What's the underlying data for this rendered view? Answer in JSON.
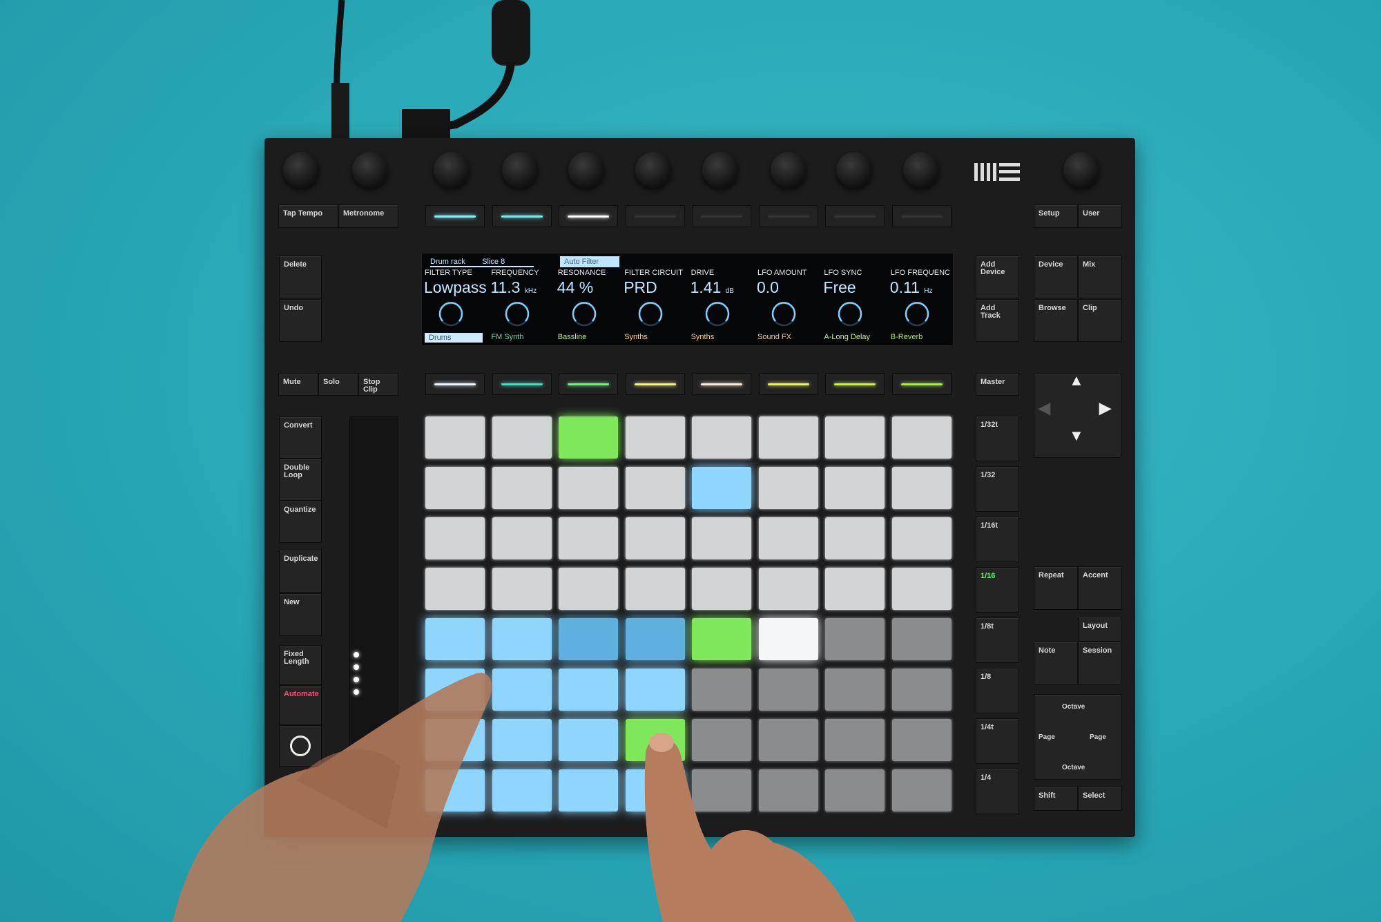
{
  "device": {
    "logo": "ableton-logo",
    "top_left_buttons": [
      "Tap Tempo",
      "Metronome"
    ],
    "edit_buttons": [
      "Delete",
      "Undo"
    ],
    "track_buttons": [
      "Mute",
      "Solo",
      "Stop Clip"
    ],
    "left_column_a": [
      "Convert",
      "Double Loop",
      "Quantize"
    ],
    "left_column_b": [
      "Duplicate",
      "New"
    ],
    "left_column_c": [
      "Fixed Length",
      "Automate"
    ],
    "add_buttons": [
      "Add Device",
      "Add Track"
    ],
    "mode_buttons": [
      "Device",
      "Mix",
      "Browse",
      "Clip"
    ],
    "setup_buttons": [
      "Setup",
      "User"
    ],
    "master": "Master",
    "scene_buttons": [
      "1/32t",
      "1/32",
      "1/16t",
      "1/16",
      "1/8t",
      "1/8",
      "1/4t",
      "1/4"
    ],
    "active_scene": "1/16",
    "repeat_buttons": [
      "Repeat",
      "Accent"
    ],
    "layout_buttons": {
      "layout": "Layout",
      "note": "Note",
      "session": "Session"
    },
    "octave_pad": {
      "up": "Octave",
      "down": "Octave",
      "left": "Page",
      "right": "Page"
    },
    "bottom_buttons": [
      "Shift",
      "Select"
    ],
    "upper_strip_leds": [
      "#8ff0ff",
      "#7fe8f0",
      "#ffffff",
      "#333",
      "#333",
      "#333",
      "#333",
      "#333"
    ],
    "lower_strip_leds": [
      "#e8f4ff",
      "#3fe0c0",
      "#6ef07a",
      "#f2f07a",
      "#ffe8d0",
      "#e8f060",
      "#c8f040",
      "#a0f040"
    ]
  },
  "display": {
    "breadcrumb": [
      "Drum rack",
      "Slice 8"
    ],
    "device_tab": "Auto Filter",
    "params": [
      {
        "name": "FILTER TYPE",
        "value": "Lowpass",
        "unit": ""
      },
      {
        "name": "FREQUENCY",
        "value": "11.3",
        "unit": "kHz"
      },
      {
        "name": "RESONANCE",
        "value": "44 %",
        "unit": ""
      },
      {
        "name": "FILTER CIRCUIT",
        "value": "PRD",
        "unit": ""
      },
      {
        "name": "DRIVE",
        "value": "1.41",
        "unit": "dB"
      },
      {
        "name": "LFO AMOUNT",
        "value": "0.0",
        "unit": ""
      },
      {
        "name": "LFO SYNC",
        "value": "Free",
        "unit": ""
      },
      {
        "name": "LFO FREQUENC",
        "value": "0.11",
        "unit": "Hz"
      }
    ],
    "tracks": [
      {
        "name": "Drums",
        "color": "#cfe9ff"
      },
      {
        "name": "FM Synth",
        "color": "#6fd6a0"
      },
      {
        "name": "Bassline",
        "color": "#b8f08a"
      },
      {
        "name": "Synths",
        "color": "#ffd36a"
      },
      {
        "name": "Synths",
        "color": "#ffd36a"
      },
      {
        "name": "Sound FX",
        "color": "#f2c89a"
      },
      {
        "name": "A-Long Delay",
        "color": "#c8f07a"
      },
      {
        "name": "B-Reverb",
        "color": "#b0f040"
      }
    ]
  },
  "pads": [
    [
      "g",
      "g",
      "G",
      "g",
      "g",
      "g",
      "g",
      "g"
    ],
    [
      "g",
      "g",
      "g",
      "g",
      "B",
      "g",
      "g",
      "g"
    ],
    [
      "g",
      "g",
      "g",
      "g",
      "g",
      "g",
      "g",
      "g"
    ],
    [
      "g",
      "g",
      "g",
      "g",
      "g",
      "g",
      "g",
      "g"
    ],
    [
      "B",
      "B",
      "b",
      "b",
      "G",
      "W",
      "d",
      "d"
    ],
    [
      "B",
      "B",
      "B",
      "B",
      "d",
      "d",
      "d",
      "d"
    ],
    [
      "B",
      "B",
      "B",
      "G",
      "d",
      "d",
      "d",
      "d"
    ],
    [
      "B",
      "B",
      "B",
      "B",
      "d",
      "d",
      "d",
      "d"
    ]
  ],
  "pad_colors": {
    "g": "#d2d4d6",
    "G": "#7ee85a",
    "B": "#8fd6ff",
    "b": "#5fb0de",
    "W": "#f4f6f8",
    "d": "#8a8c8e"
  }
}
